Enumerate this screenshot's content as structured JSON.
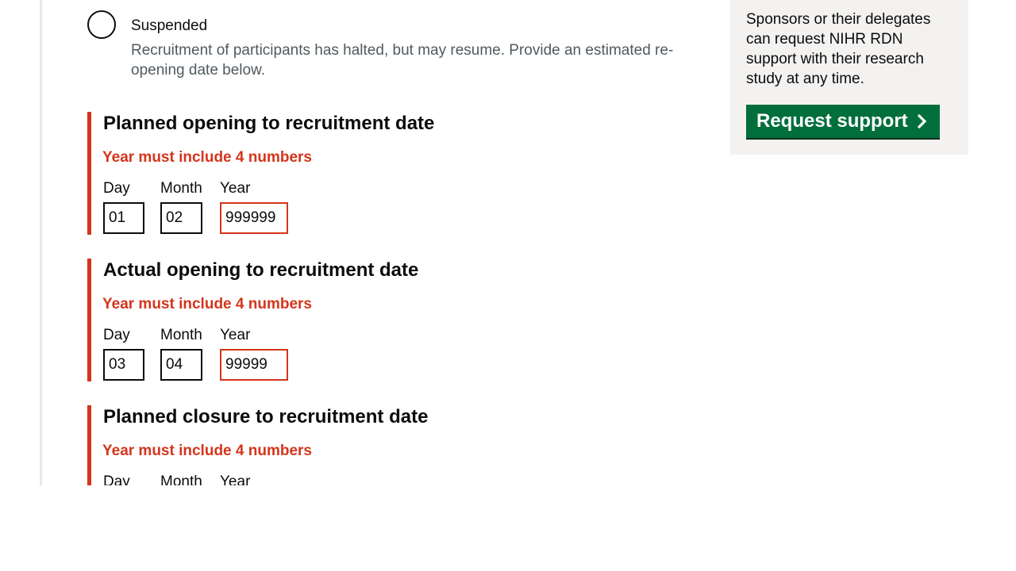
{
  "status_option": {
    "label": "Suspended",
    "hint": "Recruitment of participants has halted, but may resume. Provide an estimated re-opening date below."
  },
  "date_fields": [
    {
      "legend": "Planned opening to recruitment date",
      "error": "Year must include 4 numbers",
      "day_label": "Day",
      "month_label": "Month",
      "year_label": "Year",
      "day_value": "01",
      "month_value": "02",
      "year_value": "999999"
    },
    {
      "legend": "Actual opening to recruitment date",
      "error": "Year must include 4 numbers",
      "day_label": "Day",
      "month_label": "Month",
      "year_label": "Year",
      "day_value": "03",
      "month_value": "04",
      "year_value": "99999"
    },
    {
      "legend": "Planned closure to recruitment date",
      "error": "Year must include 4 numbers",
      "day_label": "Day",
      "month_label": "Month",
      "year_label": "Year"
    }
  ],
  "sidebar": {
    "text": "Sponsors or their delegates can request NIHR RDN support with their research study at any time.",
    "button_label": "Request support",
    "button_icon": "chevron-right-icon"
  },
  "colors": {
    "error": "#d4351c",
    "button": "#006f3c",
    "sidebar_bg": "#f3f2f1",
    "hint": "#505a5f"
  }
}
